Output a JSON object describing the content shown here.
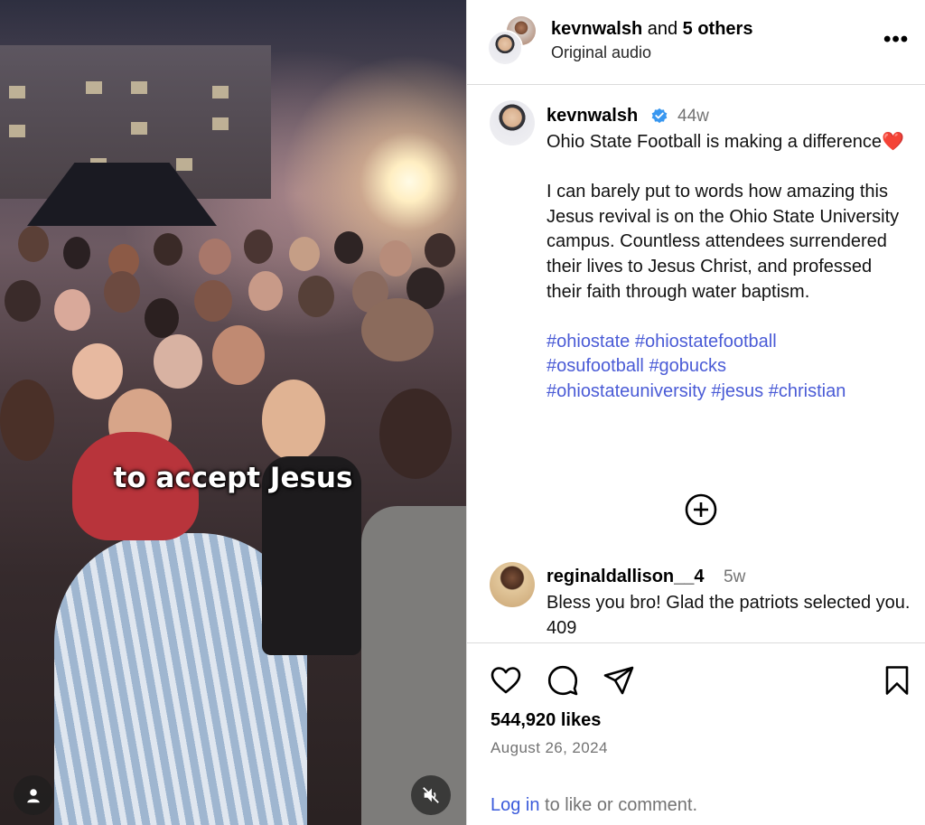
{
  "video": {
    "caption": "to accept Jesus",
    "profile_icon": "person-icon",
    "mute_icon": "volume-muted-icon"
  },
  "header": {
    "username": "kevnwalsh",
    "joiner": " and ",
    "others": "5 others",
    "audio": "Original audio",
    "more_icon": "more-options-icon",
    "more_label": "•••"
  },
  "post": {
    "username": "kevnwalsh",
    "verified_icon": "verified-badge-icon",
    "age": "44w",
    "caption_line1": "Ohio State Football is making a difference❤️",
    "caption_line2": "I can barely put to words how amazing this Jesus revival is on the Ohio State University campus. Countless attendees surrendered their lives to Jesus Christ, and professed their faith through water baptism.",
    "hashtags": [
      "#ohiostate",
      "#ohiostatefootball",
      "#osufootball",
      "#gobucks",
      "#ohiostateuniversity",
      "#jesus",
      "#christian"
    ],
    "load_more_icon": "plus-circle-icon"
  },
  "comment": {
    "username": "reginaldallison__4",
    "age": "5w",
    "text": "Bless you bro! Glad the patriots selected you. 409"
  },
  "actions": {
    "like_icon": "heart-icon",
    "comment_icon": "comment-icon",
    "share_icon": "share-icon",
    "save_icon": "bookmark-icon",
    "likes": "544,920 likes",
    "date": "August 26, 2024",
    "login_link": "Log in",
    "login_rest": " to like or comment."
  },
  "colors": {
    "link": "#3b5bdb",
    "hashtag": "#4a5bd6",
    "muted_text": "#737373",
    "divider": "#dbdbdb",
    "verified": "#3897f0"
  }
}
